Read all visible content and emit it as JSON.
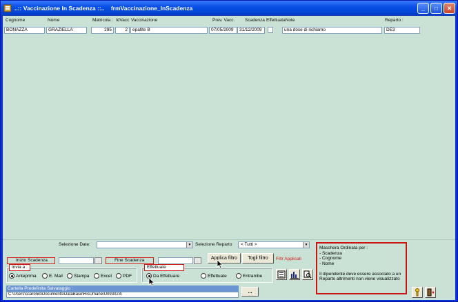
{
  "window": {
    "title": "..:: Vaccinazione In Scadenza ::..    frmVaccinazione_InScadenza"
  },
  "headers": [
    "Cognome",
    "Nome",
    "Matricola :",
    "IdVacc",
    "Vaccinazione",
    "Prev. Vacc.",
    "Scadenza",
    "EffettuataNote",
    "Reparto :"
  ],
  "row": {
    "cognome": "BONAZZA",
    "nome": "GRAZIELLA",
    "matricola": "295",
    "idvacc": "2",
    "vaccinazione": "epatite B",
    "prev_vacc": "07/05/2009",
    "scadenza": "31/12/2009",
    "note": "una dose di richiamo",
    "reparto": "DE3"
  },
  "filters": {
    "selezione_date_label": "Selezione Date:",
    "selezione_reparto_label": "Selezione Reparto",
    "reparto_value": "<  Tutti  >",
    "inizio_label": "Inizio Scadenza",
    "fine_label": "Fine Scadenza",
    "applica": "Applica filtro",
    "togli": "Togli filtro",
    "filtro_status": "Filtr Applicati"
  },
  "invia": {
    "title": "Invia a :",
    "options": [
      "Anteprima",
      "E. Mail",
      "Stampa",
      "Excel",
      "PDF"
    ]
  },
  "effettuate": {
    "title": "Effettuate",
    "options": [
      "Da Effettuare",
      "Effettuate",
      "Entrambe"
    ]
  },
  "cartella": {
    "label": "Cartella Predefinita Salvataggio :",
    "path": "C:\\Users\\scaronic\\Documents\\DataBase\\RisUmane\\U093023\\",
    "browse": "..."
  },
  "note": {
    "text": "Maschera Ordinata per :\n- Scadenza\n- Cognome\n- Nome\n\nIl dipendente deve essere associato a un Reparto altrimenti non viene visualizzato"
  },
  "colors": {
    "accent": "#0a50e6",
    "bg": "#c9e2d5",
    "alert": "#c81616"
  }
}
